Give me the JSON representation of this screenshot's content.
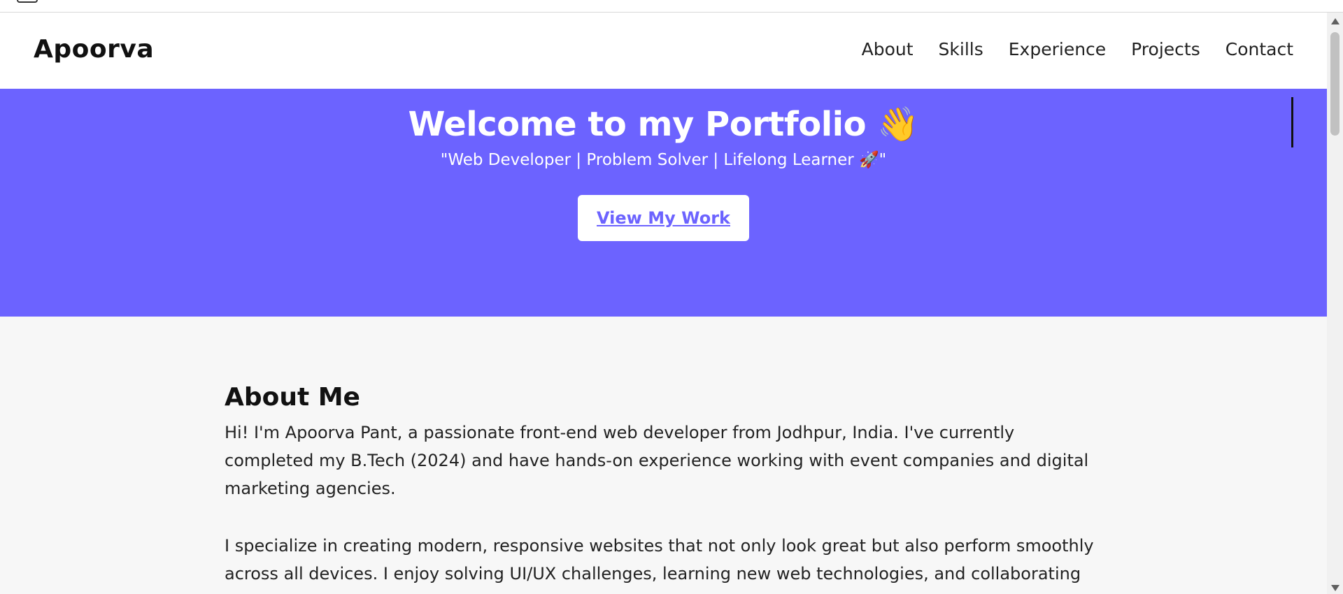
{
  "nav": {
    "brand": "Apoorva",
    "links": [
      "About",
      "Skills",
      "Experience",
      "Projects",
      "Contact"
    ]
  },
  "hero": {
    "title": "Welcome to my Portfolio 👋",
    "subtitle": "\"Web Developer | Problem Solver | Lifelong Learner 🚀\"",
    "cta_label": "View My Work"
  },
  "about": {
    "heading": "About Me",
    "paragraphs": [
      "Hi! I'm Apoorva Pant, a passionate front-end web developer from Jodhpur, India. I've currently completed my B.Tech (2024) and have hands-on experience working with event companies and digital marketing agencies.",
      "I specialize in creating modern, responsive websites that not only look great but also perform smoothly across all devices. I enjoy solving UI/UX challenges, learning new web technologies, and collaborating"
    ]
  },
  "colors": {
    "accent": "#6c63ff",
    "text": "#111111",
    "background": "#f7f7f7"
  },
  "icons": {
    "scroll_up": "arrow-up-icon",
    "scroll_down": "arrow-down-icon"
  }
}
